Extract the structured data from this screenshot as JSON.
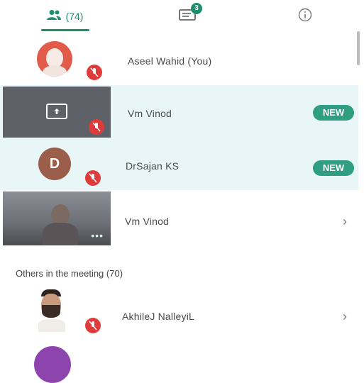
{
  "tabs": {
    "people_count": "(74)",
    "chat_badge": "3"
  },
  "participants": [
    {
      "name": "Aseel Wahid (You)"
    },
    {
      "name": "Vm Vinod",
      "badge": "NEW"
    },
    {
      "name": "DrSajan KS",
      "badge": "NEW",
      "avatar_letter": "D"
    },
    {
      "name": "Vm Vinod"
    }
  ],
  "others": {
    "label": "Others in the meeting (70)",
    "items": [
      {
        "name": "AkhileJ NalleyiL"
      }
    ]
  },
  "colors": {
    "accent": "#1e8e6e",
    "mute": "#e03b3b",
    "highlight": "#e8f6f8"
  }
}
